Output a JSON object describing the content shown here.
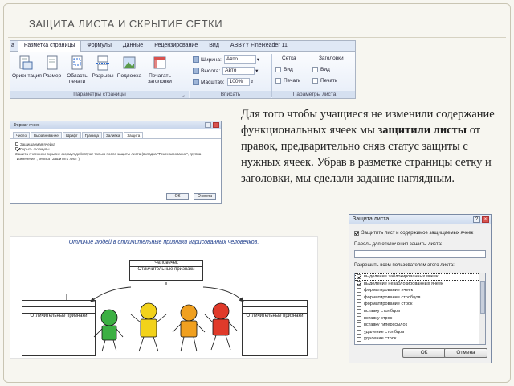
{
  "slide": {
    "title": "ЗАЩИТА ЛИСТА И СКРЫТИЕ СЕТКИ"
  },
  "ribbon": {
    "tabs": [
      "а",
      "Разметка страницы",
      "Формулы",
      "Данные",
      "Рецензирование",
      "Вид",
      "ABBYY FineReader 11"
    ],
    "active_tab": "Разметка страницы",
    "page_setup": {
      "buttons": [
        "Ориентация",
        "Размер",
        "Область печати",
        "Разрывы",
        "Подложка",
        "Печатать заголовки"
      ],
      "group_label": "Параметры страницы"
    },
    "fit": {
      "width_label": "Ширина:",
      "width_value": "Авто",
      "height_label": "Высота:",
      "height_value": "Авто",
      "scale_label": "Масштаб:",
      "scale_value": "100%",
      "group_label": "Вписать"
    },
    "sheet_options": {
      "grid_label": "Сетка",
      "headings_label": "Заголовки",
      "view_label": "Вид",
      "print_label": "Печать",
      "group_label": "Параметры листа"
    }
  },
  "paragraph": {
    "part1": "Для того чтобы учащиеся не изменили содержание функциональных ячеек мы ",
    "bold": "защитили листы",
    "part2": " от  правок, предварительно сняв статус защиты с нужных ячеек. Убрав в разметке страницы сетку и заголовки, мы сделали задание наглядным."
  },
  "format_dialog": {
    "title": "Формат ячеек",
    "tabs": [
      "Число",
      "Выравнивание",
      "Шрифт",
      "Граница",
      "Заливка",
      "Защита"
    ],
    "options": [
      "Защищаемая ячейка",
      "Скрыть формулы"
    ],
    "note": "Защита ячеек или скрытие формул действуют только после защиты листа (вкладка \"Рецензирование\", группа \"Изменения\", кнопка \"Защитить лист\").",
    "ok": "ОК",
    "cancel": "Отмена"
  },
  "diagram": {
    "title": "Отличие людей в отличительные признаки нарисованных человечков.",
    "top_box": [
      "Человечек",
      "Отличительные признаки"
    ],
    "left_box_label": "Отличительные признаки",
    "right_box_label": "Отличительные признаки"
  },
  "protect_dialog": {
    "title": "Защита листа",
    "protect_check": "Защитить лист и содержимое защищаемых ячеек",
    "password_label": "Пароль для отключения защиты листа:",
    "allow_label": "Разрешить всем пользователям этого листа:",
    "items": [
      {
        "label": "выделение заблокированных ячеек",
        "checked": true
      },
      {
        "label": "выделение незаблокированных ячеек",
        "checked": true
      },
      {
        "label": "форматирование ячеек",
        "checked": false
      },
      {
        "label": "форматирование столбцов",
        "checked": false
      },
      {
        "label": "форматирование строк",
        "checked": false
      },
      {
        "label": "вставку столбцов",
        "checked": false
      },
      {
        "label": "вставку строк",
        "checked": false
      },
      {
        "label": "вставку гиперссылок",
        "checked": false
      },
      {
        "label": "удаление столбцов",
        "checked": false
      },
      {
        "label": "удаление строк",
        "checked": false
      }
    ],
    "ok": "ОК",
    "cancel": "Отмена"
  },
  "colors": {
    "figure_green": "#3cb043",
    "figure_yellow": "#f2d21b",
    "figure_orange": "#f0a020",
    "figure_red": "#e03a2a"
  }
}
